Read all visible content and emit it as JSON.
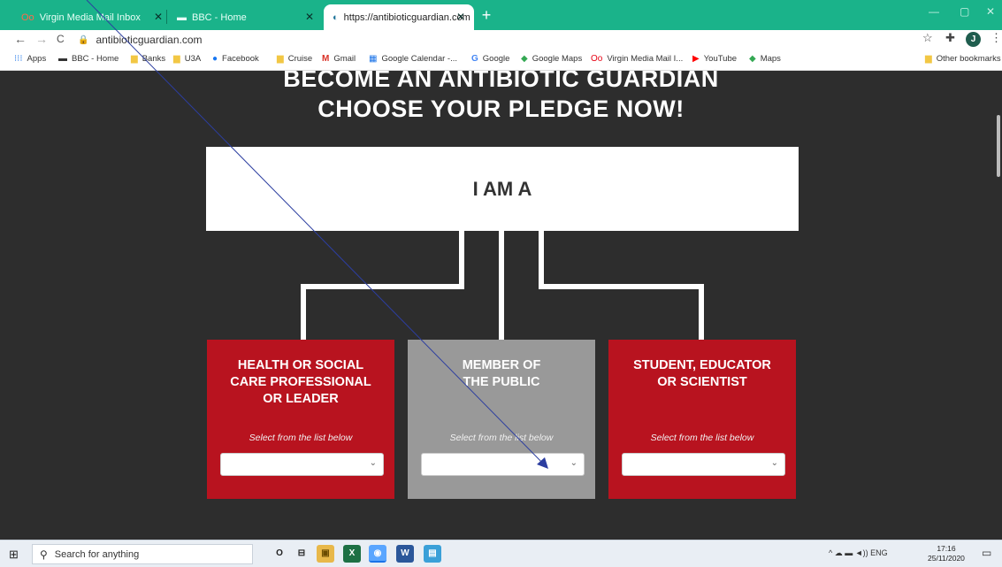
{
  "browser": {
    "tabs": [
      {
        "icon": "Oo",
        "title": "Virgin Media Mail Inbox",
        "active": false
      },
      {
        "icon": "▬",
        "title": "BBC - Home",
        "active": false
      },
      {
        "icon": "◐",
        "title": "https://antibioticguardian.com",
        "active": true
      }
    ],
    "new_tab_label": "+",
    "window_controls": {
      "minimize": "—",
      "maximize": "▢",
      "close": "✕"
    },
    "nav": {
      "back": "←",
      "forward": "→",
      "reload": "C"
    },
    "url": "antibioticguardian.com",
    "avatar_letter": "J",
    "toolbar_icons": {
      "star": "☆",
      "extensions": "✚",
      "menu": "⋮"
    },
    "bookmarks": [
      {
        "icon": "⁝⁝⁝",
        "label": "Apps"
      },
      {
        "icon": "▬",
        "label": "BBC - Home"
      },
      {
        "icon": "▆",
        "label": "Banks"
      },
      {
        "icon": "▆",
        "label": "U3A"
      },
      {
        "icon": "●",
        "label": "Facebook"
      },
      {
        "icon": "▆",
        "label": "Cruise"
      },
      {
        "icon": "M",
        "label": "Gmail"
      },
      {
        "icon": "▦",
        "label": "Google Calendar -..."
      },
      {
        "icon": "G",
        "label": "Google"
      },
      {
        "icon": "◆",
        "label": "Google Maps"
      },
      {
        "icon": "Oo",
        "label": "Virgin Media Mail I..."
      },
      {
        "icon": "▶",
        "label": "YouTube"
      },
      {
        "icon": "◆",
        "label": "Maps"
      }
    ],
    "other_bookmarks": "Other bookmarks"
  },
  "page": {
    "headline_1": "BECOME AN ANTIBIOTIC GUARDIAN",
    "headline_2": "CHOOSE YOUR PLEDGE NOW!",
    "iam_label": "I AM A",
    "cards": [
      {
        "title": "HEALTH OR SOCIAL\nCARE PROFESSIONAL\nOR LEADER",
        "hint": "Select from the list below",
        "selected": "",
        "color": "#b8131f"
      },
      {
        "title": "MEMBER OF\nTHE PUBLIC",
        "hint": "Select from the list below",
        "selected": "",
        "color": "#999999"
      },
      {
        "title": "STUDENT, EDUCATOR\nOR SCIENTIST",
        "hint": "Select from the list below",
        "selected": "",
        "color": "#b8131f"
      }
    ]
  },
  "taskbar": {
    "search_placeholder": "Search for anything",
    "apps": [
      "O",
      "⊟",
      "▣",
      "X",
      "◉",
      "W",
      "▤"
    ],
    "tray_text": "^  ☁  ▬  ◄))  ENG",
    "time": "17:16",
    "date": "25/11/2020"
  },
  "colors": {
    "tab_strip": "#1ab38a",
    "card_red": "#b8131f",
    "card_grey": "#999999",
    "page_bg": "#2d2d2d"
  }
}
